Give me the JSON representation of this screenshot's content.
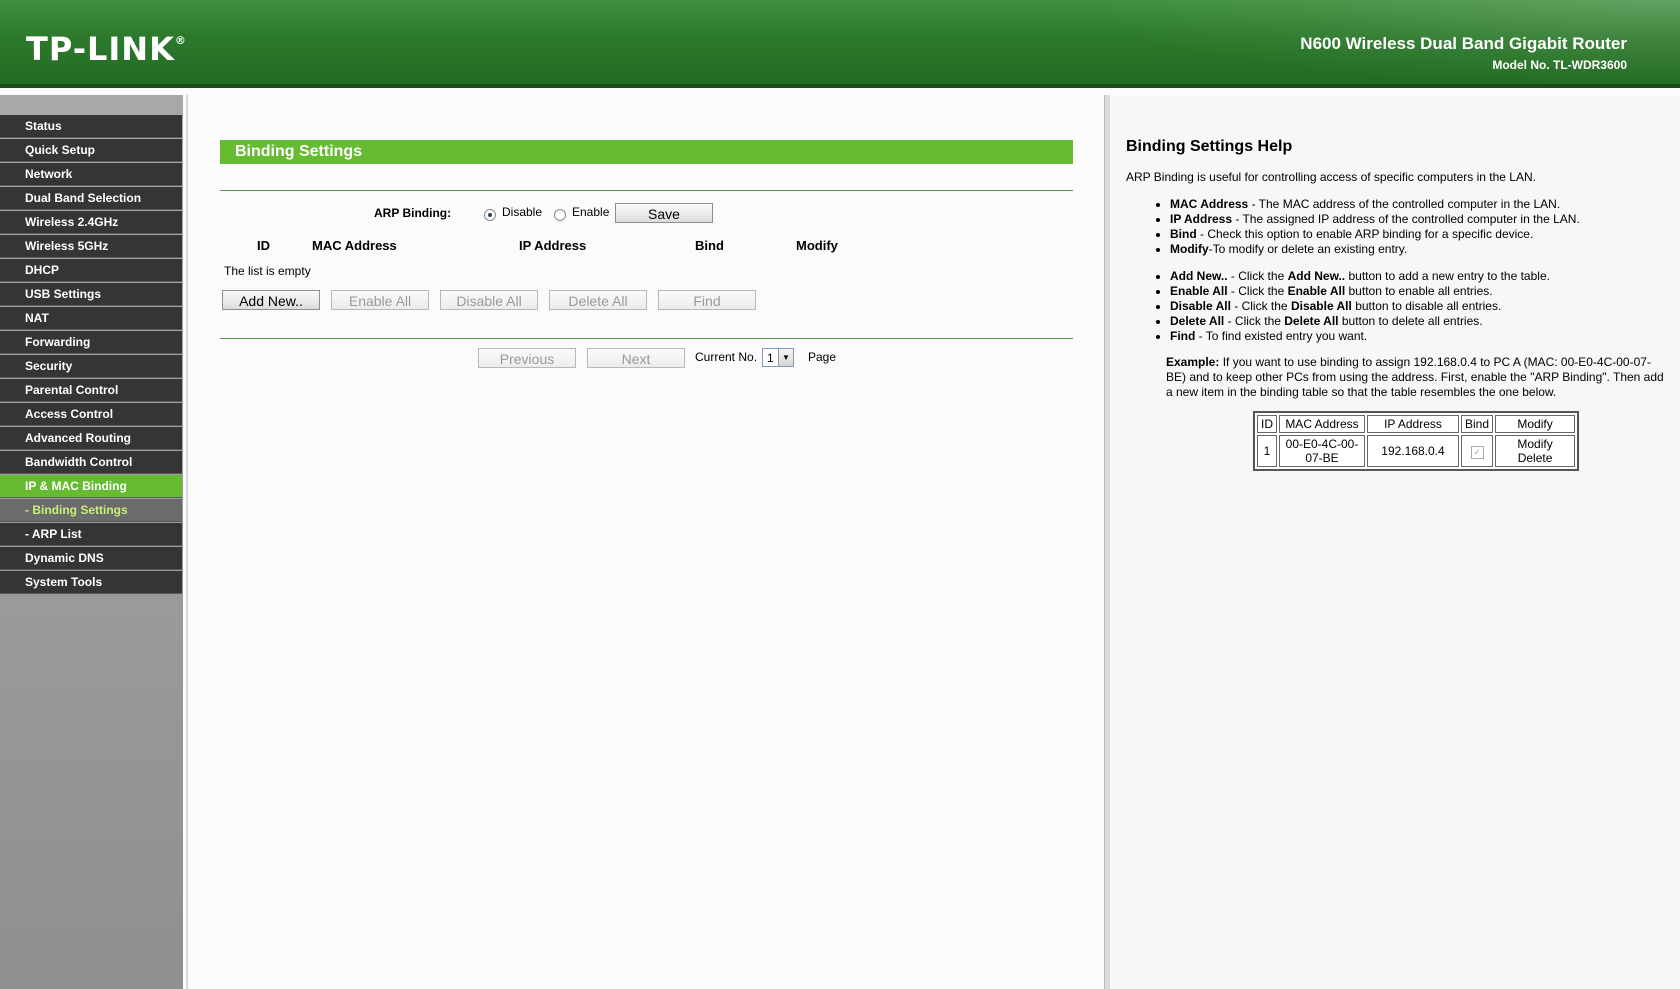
{
  "header": {
    "logo": "TP-LINK",
    "logo_mark": "®",
    "product": "N600 Wireless Dual Band Gigabit Router",
    "model": "Model No. TL-WDR3600"
  },
  "sidebar": {
    "items": [
      {
        "label": "Status"
      },
      {
        "label": "Quick Setup"
      },
      {
        "label": "Network"
      },
      {
        "label": "Dual Band Selection"
      },
      {
        "label": "Wireless 2.4GHz"
      },
      {
        "label": "Wireless 5GHz"
      },
      {
        "label": "DHCP"
      },
      {
        "label": "USB Settings"
      },
      {
        "label": "NAT"
      },
      {
        "label": "Forwarding"
      },
      {
        "label": "Security"
      },
      {
        "label": "Parental Control"
      },
      {
        "label": "Access Control"
      },
      {
        "label": "Advanced Routing"
      },
      {
        "label": "Bandwidth Control"
      },
      {
        "label": "IP & MAC Binding"
      },
      {
        "label": "- Binding Settings"
      },
      {
        "label": "- ARP List"
      },
      {
        "label": "Dynamic DNS"
      },
      {
        "label": "System Tools"
      }
    ]
  },
  "main": {
    "title": "Binding Settings",
    "arp_label": "ARP Binding:",
    "disable_label": "Disable",
    "enable_label": "Enable",
    "save_label": "Save",
    "columns": [
      "ID",
      "MAC Address",
      "IP Address",
      "Bind",
      "Modify"
    ],
    "empty_text": "The list is empty",
    "buttons": {
      "add_new": "Add New..",
      "enable_all": "Enable All",
      "disable_all": "Disable All",
      "delete_all": "Delete All",
      "find": "Find"
    },
    "pager": {
      "previous": "Previous",
      "next": "Next",
      "current_label": "Current No.",
      "current_value": "1",
      "page_label": "Page"
    }
  },
  "help": {
    "title": "Binding Settings Help",
    "intro": "ARP Binding is useful for controlling access of specific computers in the LAN.",
    "list1": [
      {
        "term": "MAC Address",
        "desc": " - The MAC address of the controlled computer in the LAN."
      },
      {
        "term": "IP Address",
        "desc": " - The assigned IP address of the controlled computer in the LAN."
      },
      {
        "term": "Bind",
        "desc": " - Check this option to enable ARP binding for a specific device."
      },
      {
        "term": "Modify",
        "desc": "-To modify or delete an existing entry."
      }
    ],
    "list2": [
      {
        "term": "Add New..",
        "d1": " - Click the ",
        "b": "Add New..",
        "d2": " button to add a new entry to the table."
      },
      {
        "term": "Enable All",
        "d1": " - Click the ",
        "b": "Enable All",
        "d2": " button to enable all entries."
      },
      {
        "term": "Disable All",
        "d1": " - Click the ",
        "b": "Disable All",
        "d2": " button to disable all entries."
      },
      {
        "term": "Delete All",
        "d1": " - Click the ",
        "b": "Delete All",
        "d2": " button to delete all entries."
      },
      {
        "term": "Find",
        "d1": " - To find existed entry you want.",
        "b": "",
        "d2": ""
      }
    ],
    "example_label": "Example:",
    "example_text": " If you want to use binding to assign 192.168.0.4 to PC A (MAC: 00-E0-4C-00-07-BE) and to keep other PCs from using the address. First, enable the \"ARP Binding\". Then add a new item in the binding table so that the table resembles the one below.",
    "table": {
      "headers": [
        "ID",
        "MAC Address",
        "IP Address",
        "Bind",
        "Modify"
      ],
      "row": {
        "id": "1",
        "mac": "00-E0-4C-00-07-BE",
        "ip": "192.168.0.4",
        "modify": "Modify",
        "delete": "Delete"
      }
    }
  }
}
